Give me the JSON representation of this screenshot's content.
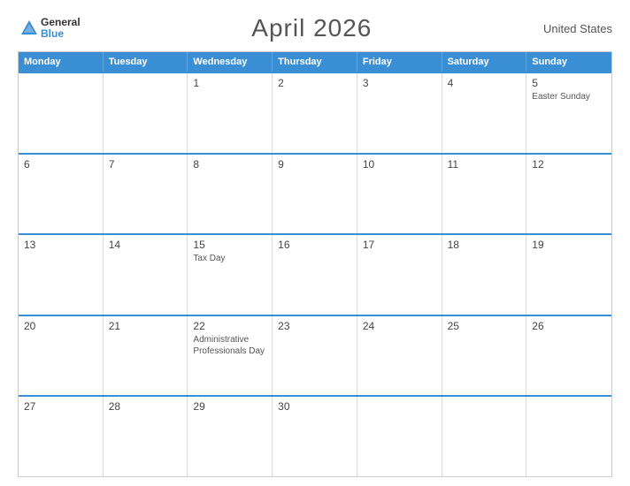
{
  "header": {
    "logo_general": "General",
    "logo_blue": "Blue",
    "title": "April 2026",
    "country": "United States"
  },
  "calendar": {
    "days_of_week": [
      "Monday",
      "Tuesday",
      "Wednesday",
      "Thursday",
      "Friday",
      "Saturday",
      "Sunday"
    ],
    "weeks": [
      [
        {
          "day": "",
          "events": []
        },
        {
          "day": "",
          "events": []
        },
        {
          "day": "1",
          "events": []
        },
        {
          "day": "2",
          "events": []
        },
        {
          "day": "3",
          "events": []
        },
        {
          "day": "4",
          "events": []
        },
        {
          "day": "5",
          "events": [
            "Easter Sunday"
          ]
        }
      ],
      [
        {
          "day": "6",
          "events": []
        },
        {
          "day": "7",
          "events": []
        },
        {
          "day": "8",
          "events": []
        },
        {
          "day": "9",
          "events": []
        },
        {
          "day": "10",
          "events": []
        },
        {
          "day": "11",
          "events": []
        },
        {
          "day": "12",
          "events": []
        }
      ],
      [
        {
          "day": "13",
          "events": []
        },
        {
          "day": "14",
          "events": []
        },
        {
          "day": "15",
          "events": [
            "Tax Day"
          ]
        },
        {
          "day": "16",
          "events": []
        },
        {
          "day": "17",
          "events": []
        },
        {
          "day": "18",
          "events": []
        },
        {
          "day": "19",
          "events": []
        }
      ],
      [
        {
          "day": "20",
          "events": []
        },
        {
          "day": "21",
          "events": []
        },
        {
          "day": "22",
          "events": [
            "Administrative Professionals Day"
          ]
        },
        {
          "day": "23",
          "events": []
        },
        {
          "day": "24",
          "events": []
        },
        {
          "day": "25",
          "events": []
        },
        {
          "day": "26",
          "events": []
        }
      ],
      [
        {
          "day": "27",
          "events": []
        },
        {
          "day": "28",
          "events": []
        },
        {
          "day": "29",
          "events": []
        },
        {
          "day": "30",
          "events": []
        },
        {
          "day": "",
          "events": []
        },
        {
          "day": "",
          "events": []
        },
        {
          "day": "",
          "events": []
        }
      ]
    ]
  }
}
